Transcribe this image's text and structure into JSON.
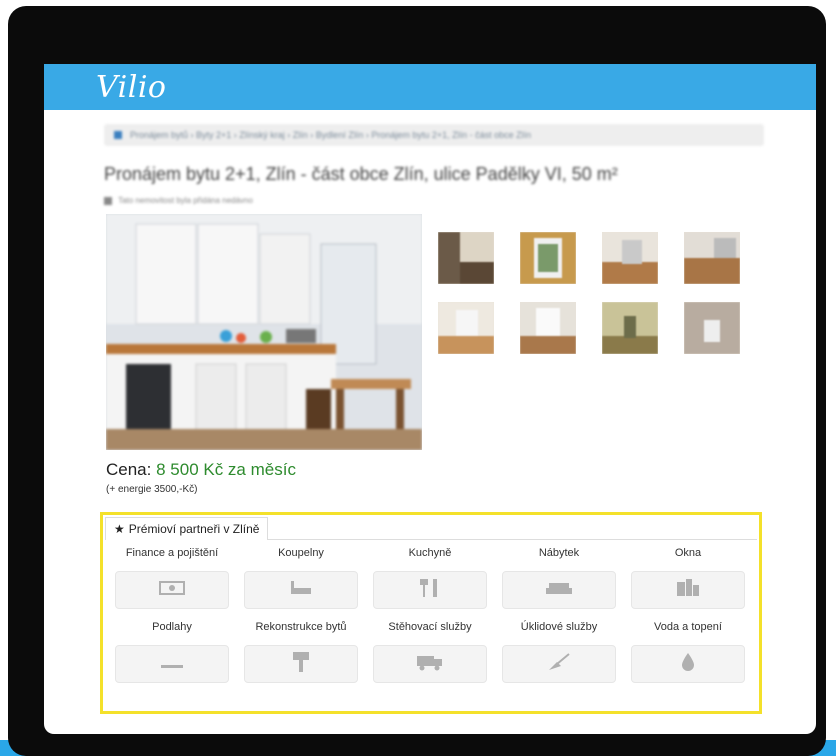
{
  "brand": {
    "logo": "Vilio",
    "color": "#39a9e6"
  },
  "breadcrumb": "Pronájem bytů › Byty 2+1 › Zlínský kraj › Zlín › Bydlení Zlín › Pronájem bytu 2+1, Zlín - část obce Zlín",
  "listing": {
    "title": "Pronájem bytu 2+1, Zlín - část obce Zlín, ulice Padělky VI, 50 m²",
    "subtitle": "Tato nemovitost byla přidána nedávno",
    "price_label": "Cena:",
    "price_value": "8 500 Kč za měsíc",
    "energy": "(+ energie 3500,-Kč)"
  },
  "partners": {
    "tab_icon": "star-icon",
    "tab_label": "Prémioví partneři v Zlíně",
    "highlight_color": "#f4e12a",
    "categories": [
      {
        "label": "Finance a pojištění",
        "icon": "money-icon"
      },
      {
        "label": "Koupelny",
        "icon": "bathtub-icon"
      },
      {
        "label": "Kuchyně",
        "icon": "cutlery-icon"
      },
      {
        "label": "Nábytek",
        "icon": "sofa-icon"
      },
      {
        "label": "Okna",
        "icon": "window-icon"
      },
      {
        "label": "Podlahy",
        "icon": "floor-icon"
      },
      {
        "label": "Rekonstrukce bytů",
        "icon": "paint-roller-icon"
      },
      {
        "label": "Stěhovací služby",
        "icon": "truck-icon"
      },
      {
        "label": "Úklidové služby",
        "icon": "broom-icon"
      },
      {
        "label": "Voda a topení",
        "icon": "water-drop-icon"
      }
    ]
  }
}
